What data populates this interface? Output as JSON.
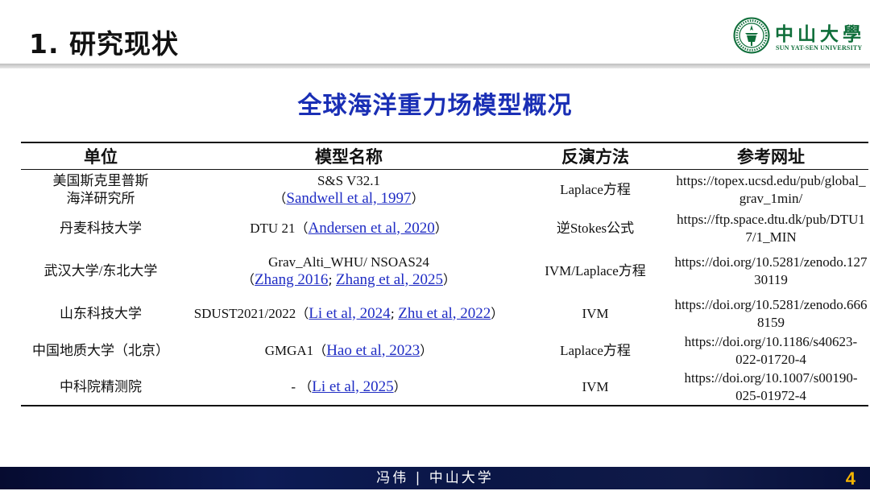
{
  "header": {
    "title": "1. 研究现状"
  },
  "logo": {
    "cn": "中山大學",
    "en": "SUN YAT-SEN UNIVERSITY"
  },
  "section": {
    "title": "全球海洋重力场模型概况"
  },
  "table": {
    "headers": [
      "单位",
      "模型名称",
      "反演方法",
      "参考网址"
    ],
    "rows": [
      {
        "inst": [
          "美国斯克里普斯",
          "海洋研究所"
        ],
        "model": "S&S V32.1",
        "refs": [
          "Sandwell et al, 1997"
        ],
        "method": "Laplace方程",
        "url": [
          "https://topex.ucsd.edu/pub/global_",
          "grav_1min/"
        ]
      },
      {
        "inst": [
          "丹麦科技大学"
        ],
        "model": "DTU 21",
        "refs": [
          "Andersen et al, 2020"
        ],
        "method": "逆Stokes公式",
        "url": [
          "https://ftp.space.dtu.dk/pub/DTU1",
          "7/1_MIN"
        ]
      },
      {
        "inst": [
          "武汉大学/东北大学"
        ],
        "model": "Grav_Alti_WHU/ NSOAS24",
        "refs": [
          "Zhang 2016",
          "Zhang et al, 2025"
        ],
        "method": "IVM/Laplace方程",
        "url": [
          "https://doi.org/10.5281/zenodo.127",
          "30119"
        ]
      },
      {
        "inst": [
          "山东科技大学"
        ],
        "model": "SDUST2021/2022",
        "refs": [
          "Li et al, 2024",
          "Zhu et al, 2022"
        ],
        "method": "IVM",
        "url": [
          "https://doi.org/10.5281/zenodo.666",
          "8159"
        ]
      },
      {
        "inst": [
          "中国地质大学（北京）"
        ],
        "model": "GMGA1",
        "refs": [
          "Hao et al, 2023"
        ],
        "method": "Laplace方程",
        "url": [
          "https://doi.org/10.1186/s40623-",
          "022-01720-4"
        ]
      },
      {
        "inst": [
          "中科院精测院"
        ],
        "model": "-",
        "refs": [
          "Li et al, 2025"
        ],
        "method": "IVM",
        "url": [
          "https://doi.org/10.1007/s00190-",
          "025-01972-4"
        ]
      }
    ]
  },
  "footer": {
    "text": "冯伟 | 中山大学",
    "page": "4"
  },
  "colors": {
    "title_blue": "#1a2fb5",
    "link_blue": "#1f2cc4",
    "logo_green": "#0f6e3a",
    "footer_navy": "#0d1b55",
    "page_num": "#f5b400"
  }
}
